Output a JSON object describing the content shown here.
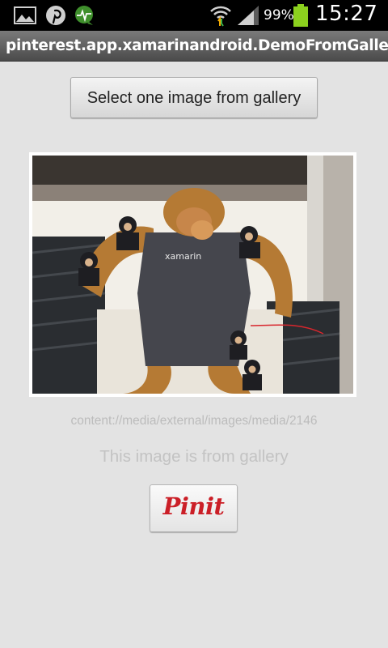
{
  "status_bar": {
    "battery_percent": "99%",
    "time": "15:27",
    "icons": [
      "gallery-icon",
      "pinterest-icon",
      "activity-monitor-icon",
      "wifi-icon",
      "signal-icon",
      "battery-icon"
    ]
  },
  "title_bar": {
    "title": "pinterest.app.xamarinandroid.DemoFromGallery"
  },
  "main": {
    "select_button_label": "Select one image from gallery",
    "image_uri": "content://media/external/images/media/2146",
    "caption": "This image is from gallery",
    "pin_button_label": "Pinit",
    "shirt_text": "xamarin"
  },
  "colors": {
    "background": "#e3e3e3",
    "pinterest_red": "#cb1f27",
    "title_bar": "#5e5e5e",
    "battery_green": "#8cd11e"
  }
}
